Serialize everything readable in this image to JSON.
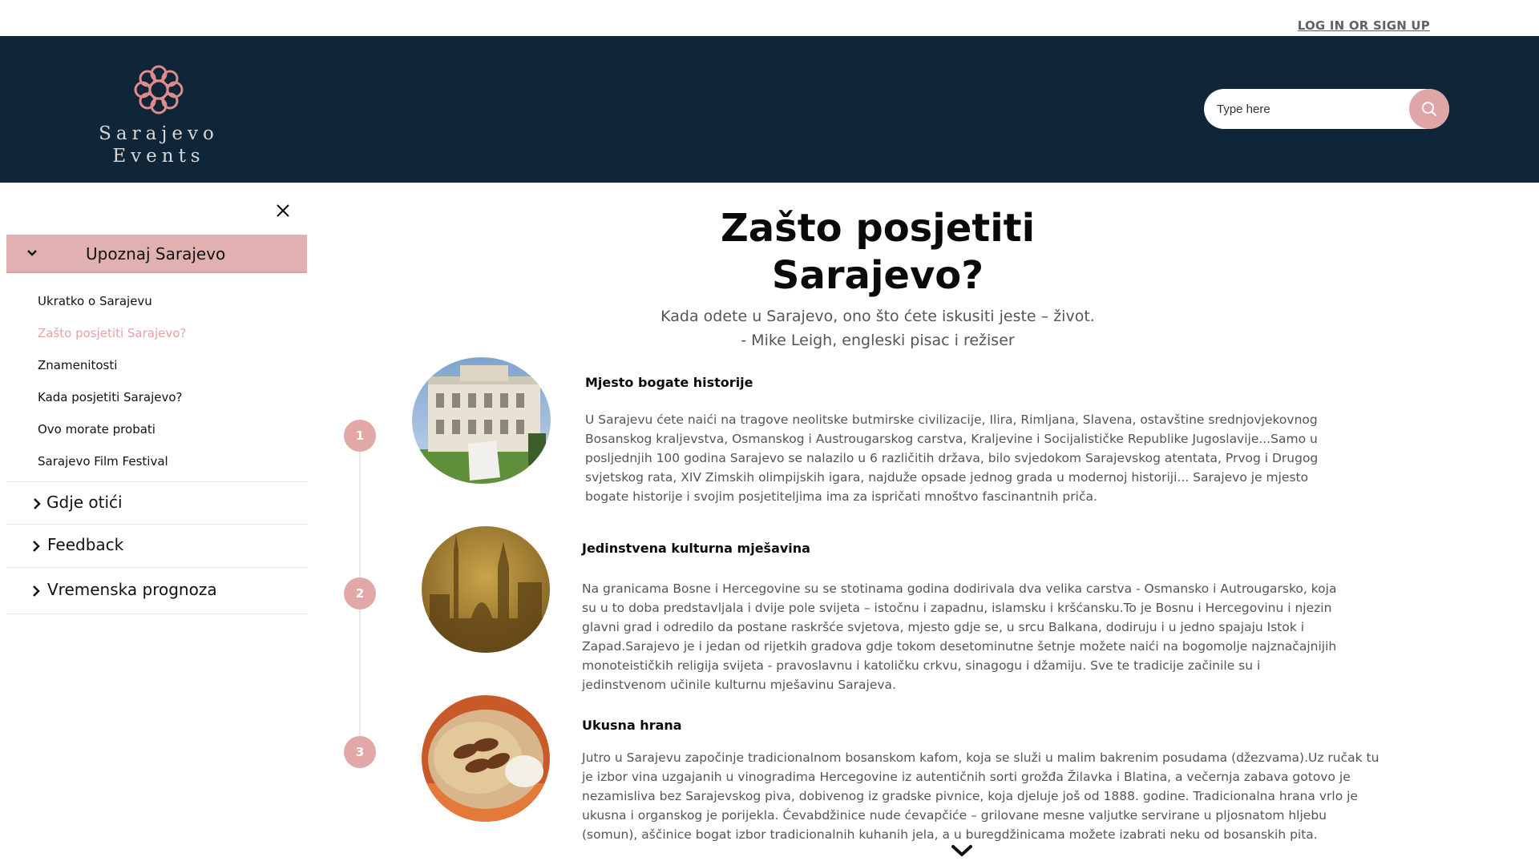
{
  "topbar": {
    "login_label": "LOG IN OR SIGN UP"
  },
  "header": {
    "logo": {
      "line1": "Sarajevo",
      "line2": "Events",
      "icon": "knot-flower-logo-icon"
    },
    "search": {
      "placeholder": "Type here",
      "value": "",
      "icon": "search-icon"
    }
  },
  "sidebar": {
    "close_icon": "close-icon",
    "open_section": {
      "label": "Upoznaj Sarajevo",
      "items": [
        {
          "label": "Ukratko o Sarajevu",
          "active": false
        },
        {
          "label": "Zašto posjetiti Sarajevo?",
          "active": true
        },
        {
          "label": "Znamenitosti",
          "active": false
        },
        {
          "label": "Kada posjetiti Sarajevo?",
          "active": false
        },
        {
          "label": "Ovo morate probati",
          "active": false
        },
        {
          "label": "Sarajevo Film Festival",
          "active": false
        }
      ]
    },
    "closed_sections": [
      {
        "label": "Gdje otići"
      },
      {
        "label": "Feedback"
      },
      {
        "label": "Vremenska prognoza"
      }
    ]
  },
  "main": {
    "title_line1": "Zašto posjetiti",
    "title_line2": "Sarajevo?",
    "quote_line1": "Kada odete u Sarajevo, ono što ćete iskusiti jeste – život.",
    "quote_line2": "- Mike Leigh, engleski pisac i režiser",
    "sections": [
      {
        "number": "1",
        "title": "Mjesto bogate historije",
        "text": "U Sarajevu ćete naići na tragove neolitske butmirske civilizacije, Ilira, Rimljana, Slavena, ostavštine srednjovjekovnog Bosanskog kraljevstva, Osmanskog i Austrougarskog carstva, Kraljevine i Socijalističke Republike Jugoslavije...Samo u posljednjih 100 godina Sarajevo se nalazilo u 6 različitih država, bilo svjedokom Sarajevskog atentata, Prvog i Drugog svjetskog rata, XIV Zimskih olimpijskih igara, najduže opsade jednog grada u modernoj historiji... Sarajevo je mjesto bogate historije i svojim posjetiteljima ima za ispričati mnoštvo fascinantnih priča.",
        "image": "museum-building-photo"
      },
      {
        "number": "2",
        "title": "Jedinstvena kulturna mješavina",
        "text": "Na granicama Bosne i Hercegovine su se stotinama godina dodirivala dva velika carstva - Osmansko i Autrougarsko, koja su u to doba predstavljala i dvije pole svijeta – istočnu i zapadnu, islamsku i kršćansku.To je Bosnu i Hercegovinu i njezin glavni grad i odredilo da postane raskršće svjetova, mjesto gdje se, u srcu Balkana, dodiruju i u jedno spajaju Istok i Zapad.Sarajevo je i jedan od rijetkih gradova gdje tokom desetominutne šetnje možete naići na bogomolje najznačajnijih monoteističkih religija svijeta - pravoslavnu i katoličku crkvu, sinagogu i džamiju. Sve te tradicije začinile su i jedinstvenom učinile kulturnu mješavinu Sarajeva.",
        "image": "city-skyline-sepia-photo"
      },
      {
        "number": "3",
        "title": "Ukusna hrana",
        "text": "Jutro u Sarajevu započinje tradicionalnom bosanskom kafom, koja se služi u malim bakrenim posudama (džezvama).Uz ručak tu je izbor vina uzgajanih u vinogradima Hercegovine iz autentičnih sorti grožđa Žilavka i Blatina, a večernja zabava gotovo je nezamisliva bez Sarajevskog piva, dobivenog iz gradske pivnice, koja djeluje još od 1888. godine. Tradicionalna hrana vrlo je ukusna i organskog je porijekla. Ćevabdžinice nude ćevapčiće – grilovane mesne valjutke servirane u pljosnatom hljebu (somun), aščinice bogat izbor tradicionalnih kuhanih jela, a u buregdžinicama možete izabrati neku od bosanskih pita.",
        "image": "cevapi-food-photo"
      }
    ],
    "scroll_icon": "chevron-down-icon"
  },
  "colors": {
    "header_bg": "#0e2638",
    "accent_pink": "#e1b1b1",
    "active_link": "#e2a3a3",
    "text_gray": "#555555"
  }
}
